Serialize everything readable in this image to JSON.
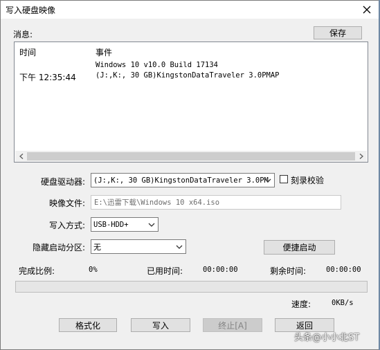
{
  "window": {
    "title": "写入硬盘映像"
  },
  "messages": {
    "label": "消息:",
    "save_label": "保存",
    "columns": {
      "time": "时间",
      "event": "事件"
    },
    "rows": [
      {
        "time": "",
        "event": "Windows 10 v10.0 Build 17134"
      },
      {
        "time": "下午 12:35:44",
        "event": "(J:,K:, 30 GB)KingstonDataTraveler 3.0PMAP"
      }
    ]
  },
  "drive": {
    "label": "硬盘驱动器:",
    "value": "(J:,K:, 30 GB)KingstonDataTraveler 3.0PM",
    "verify_label": "刻录校验",
    "verify_checked": false
  },
  "image_file": {
    "label": "映像文件:",
    "value": "E:\\迅雷下载\\Windows 10 x64.iso"
  },
  "write_method": {
    "label": "写入方式:",
    "value": "USB-HDD+"
  },
  "hidden_partition": {
    "label": "隐藏启动分区:",
    "value": "无",
    "quick_boot_label": "便捷启动"
  },
  "status": {
    "percent_label": "完成比例:",
    "percent_value": "0%",
    "elapsed_label": "已用时间:",
    "elapsed_value": "00:00:00",
    "remaining_label": "剩余时间:",
    "remaining_value": "00:00:00",
    "speed_label": "速度:",
    "speed_value": "0KB/s",
    "progress_fraction": 0
  },
  "buttons": {
    "format": "格式化",
    "write": "写入",
    "terminate": "终止[A]",
    "back": "返回"
  },
  "watermark": "头条@小小北ST",
  "colors": {
    "progress_fill": "#06b025",
    "title_background": "#ffffff",
    "dialog_background": "#f0f0f0"
  }
}
